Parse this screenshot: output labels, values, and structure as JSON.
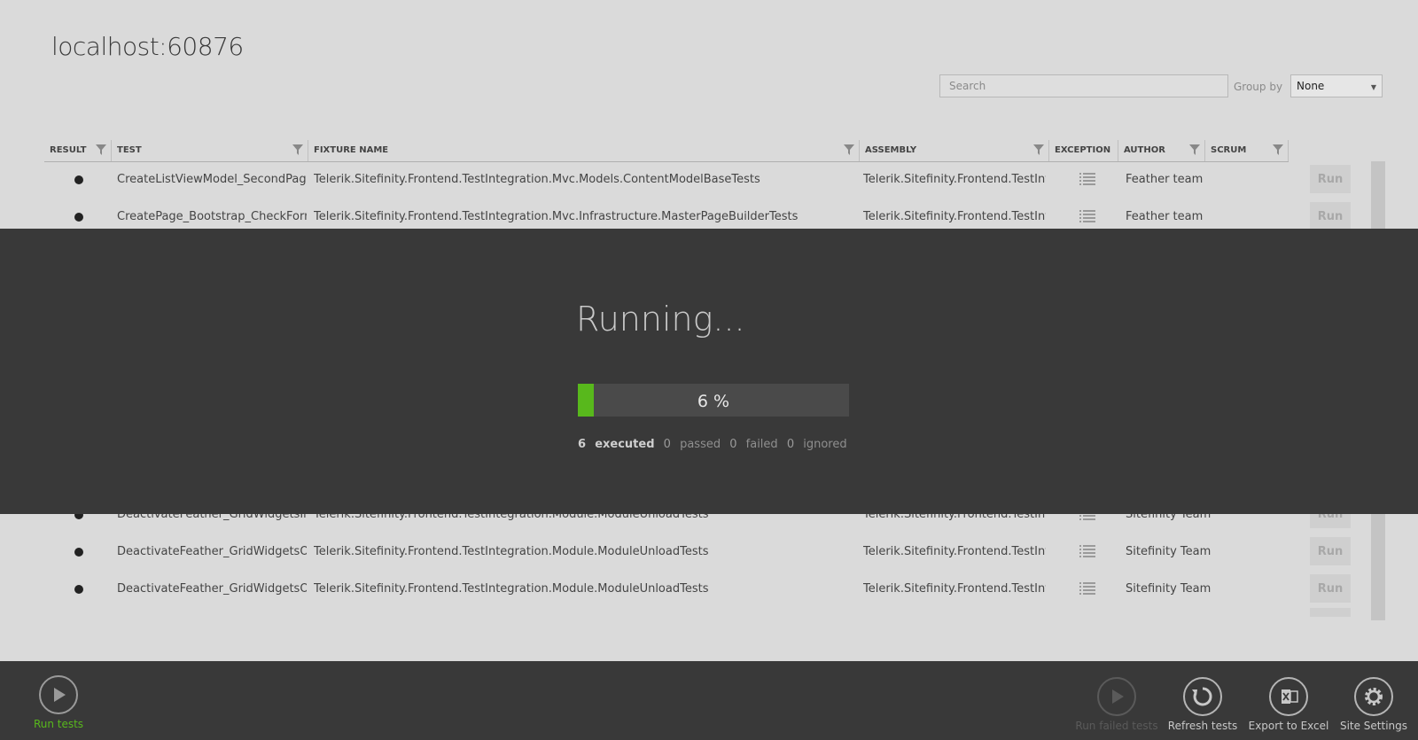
{
  "window": {
    "title": "localhost:60876"
  },
  "toolbar": {
    "search_placeholder": "Search",
    "group_by_label": "Group by",
    "group_by_value": "None"
  },
  "columns": [
    {
      "label": "RESULT",
      "filter": true
    },
    {
      "label": "TEST",
      "filter": true
    },
    {
      "label": "FIXTURE NAME",
      "filter": true
    },
    {
      "label": "ASSEMBLY",
      "filter": true
    },
    {
      "label": "EXCEPTION",
      "filter": false
    },
    {
      "label": "AUTHOR",
      "filter": true
    },
    {
      "label": "SCRUM",
      "filter": true
    }
  ],
  "rows": [
    {
      "test": "CreateListViewModel_SecondPageTi",
      "fixture": "Telerik.Sitefinity.Frontend.TestIntegration.Mvc.Models.ContentModelBaseTests",
      "assembly": "Telerik.Sitefinity.Frontend.TestInteg",
      "author": "Feather team",
      "run": "Run"
    },
    {
      "test": "CreatePage_Bootstrap_CheckFormTi",
      "fixture": "Telerik.Sitefinity.Frontend.TestIntegration.Mvc.Infrastructure.MasterPageBuilderTests",
      "assembly": "Telerik.Sitefinity.Frontend.TestInteg",
      "author": "Feather team",
      "run": "Run"
    },
    {
      "test": "",
      "fixture": "",
      "assembly": "",
      "author": "",
      "run": ""
    },
    {
      "test": "",
      "fixture": "",
      "assembly": "",
      "author": "",
      "run": ""
    },
    {
      "test": "",
      "fixture": "",
      "assembly": "",
      "author": "",
      "run": ""
    },
    {
      "test": "",
      "fixture": "",
      "assembly": "",
      "author": "",
      "run": ""
    },
    {
      "test": "",
      "fixture": "",
      "assembly": "",
      "author": "",
      "run": ""
    },
    {
      "test": "",
      "fixture": "",
      "assembly": "",
      "author": "",
      "run": ""
    },
    {
      "test": "",
      "fixture": "",
      "assembly": "",
      "author": "",
      "run": ""
    },
    {
      "test": "DeactivateFeather_GridWidgetsInTo",
      "fixture": "Telerik.Sitefinity.Frontend.TestIntegration.Module.ModuleUnloadTests",
      "assembly": "Telerik.Sitefinity.Frontend.TestInteg",
      "author": "Sitefinity Team",
      "run": "Run"
    },
    {
      "test": "DeactivateFeather_GridWidgetsOnF",
      "fixture": "Telerik.Sitefinity.Frontend.TestIntegration.Module.ModuleUnloadTests",
      "assembly": "Telerik.Sitefinity.Frontend.TestInteg",
      "author": "Sitefinity Team",
      "run": "Run"
    },
    {
      "test": "DeactivateFeather_GridWidgetsOnF",
      "fixture": "Telerik.Sitefinity.Frontend.TestIntegration.Module.ModuleUnloadTests",
      "assembly": "Telerik.Sitefinity.Frontend.TestInteg",
      "author": "Sitefinity Team",
      "run": "Run"
    }
  ],
  "progress": {
    "title": "Running...",
    "percent_label": "6 %",
    "fraction": 0.06,
    "executed_count": "6",
    "executed_label": "executed",
    "passed_count": "0",
    "passed_label": "passed",
    "failed_count": "0",
    "failed_label": "failed",
    "ignored_count": "0",
    "ignored_label": "ignored",
    "color": "#58b81c"
  },
  "bottom_actions": {
    "run_tests": "Run tests",
    "run_failed_tests": "Run failed tests",
    "refresh_tests": "Refresh tests",
    "export_to_excel": "Export to Excel",
    "site_settings": "Site Settings"
  },
  "colors": {
    "accent": "#58b81c",
    "bar_bg": "#393939",
    "page_bg": "#dadada"
  }
}
